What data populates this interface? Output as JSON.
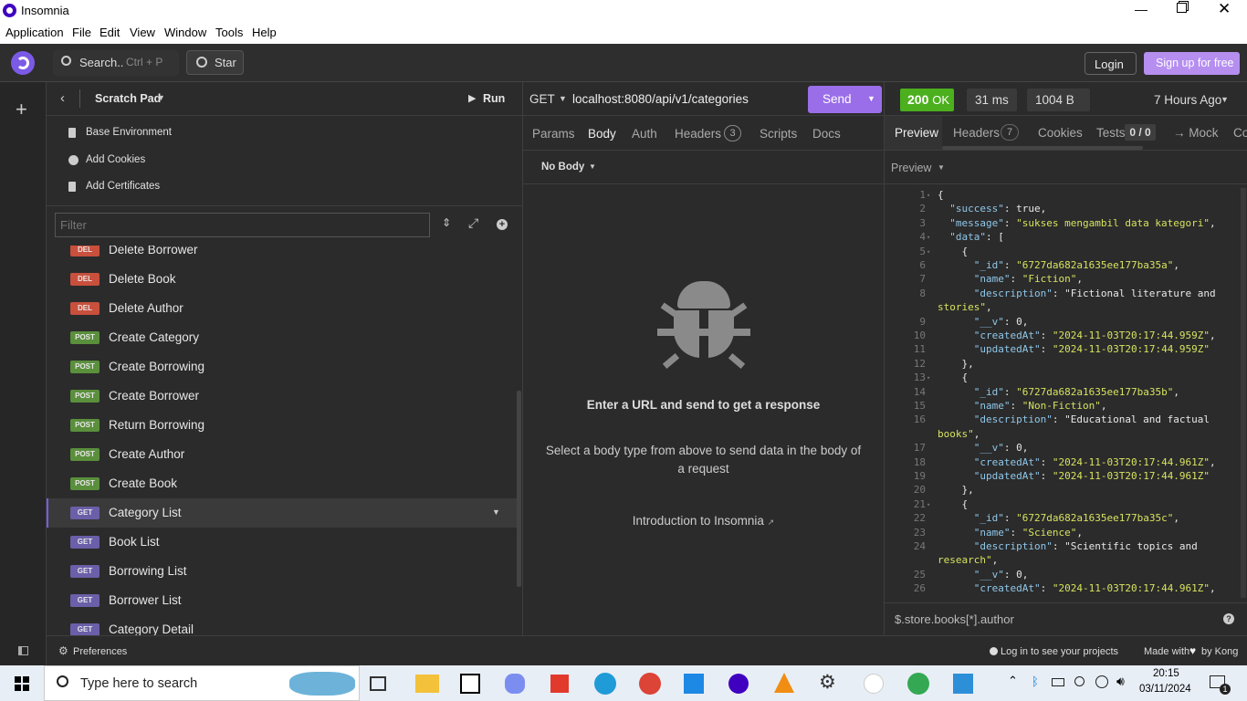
{
  "window": {
    "title": "Insomnia",
    "menu": [
      "Application",
      "File",
      "Edit",
      "View",
      "Window",
      "Tools",
      "Help"
    ]
  },
  "topbar": {
    "search_label": "Search..",
    "search_shortcut": "Ctrl + P",
    "star_label": "Star",
    "login_label": "Login",
    "signup_label": "Sign up for free"
  },
  "sidebar": {
    "title": "Scratch Pad",
    "run_label": "Run",
    "links": [
      "Base Environment",
      "Add Cookies",
      "Add Certificates"
    ],
    "filter_placeholder": "Filter",
    "requests": [
      {
        "method": "DEL",
        "name": "Delete Borrower"
      },
      {
        "method": "DEL",
        "name": "Delete Book"
      },
      {
        "method": "DEL",
        "name": "Delete Author"
      },
      {
        "method": "POST",
        "name": "Create Category"
      },
      {
        "method": "POST",
        "name": "Create Borrowing"
      },
      {
        "method": "POST",
        "name": "Create Borrower"
      },
      {
        "method": "POST",
        "name": "Return Borrowing"
      },
      {
        "method": "POST",
        "name": "Create Author"
      },
      {
        "method": "POST",
        "name": "Create Book"
      },
      {
        "method": "GET",
        "name": "Category List"
      },
      {
        "method": "GET",
        "name": "Book List"
      },
      {
        "method": "GET",
        "name": "Borrowing List"
      },
      {
        "method": "GET",
        "name": "Borrower List"
      },
      {
        "method": "GET",
        "name": "Category Detail"
      }
    ],
    "active_request": "Category List"
  },
  "request": {
    "method": "GET",
    "url": "localhost:8080/api/v1/categories",
    "send_label": "Send",
    "tabs": [
      "Params",
      "Body",
      "Auth",
      "Headers",
      "Scripts",
      "Docs"
    ],
    "headers_count": "3",
    "active_tab": "Body",
    "body_type": "No Body",
    "empty_title": "Enter a URL and send to get a response",
    "empty_desc": "Select a body type from above to send data in the body of a request",
    "intro_link": "Introduction to Insomnia"
  },
  "response": {
    "status": "200",
    "status_text": "OK",
    "time": "31 ms",
    "size": "1004 B",
    "age": "7 Hours Ago",
    "tabs": [
      "Preview",
      "Headers",
      "Cookies",
      "Tests",
      "→ Mock",
      "Co"
    ],
    "headers_count": "7",
    "tests_count": "0 / 0",
    "preview_label": "Preview",
    "filter_text": "$.store.books[*].author",
    "lines": [
      {
        "n": "1",
        "fold": true,
        "t": "{"
      },
      {
        "n": "2",
        "t": "  \"success\": true,"
      },
      {
        "n": "3",
        "t": "  \"message\": \"sukses mengambil data kategori\","
      },
      {
        "n": "4",
        "fold": true,
        "t": "  \"data\": ["
      },
      {
        "n": "5",
        "fold": true,
        "t": "    {"
      },
      {
        "n": "6",
        "t": "      \"_id\": \"6727da682a1635ee177ba35a\","
      },
      {
        "n": "7",
        "t": "      \"name\": \"Fiction\","
      },
      {
        "n": "8",
        "t": "      \"description\": \"Fictional literature and"
      },
      {
        "n": "",
        "t": "stories\","
      },
      {
        "n": "9",
        "t": "      \"__v\": 0,"
      },
      {
        "n": "10",
        "t": "      \"createdAt\": \"2024-11-03T20:17:44.959Z\","
      },
      {
        "n": "11",
        "t": "      \"updatedAt\": \"2024-11-03T20:17:44.959Z\""
      },
      {
        "n": "12",
        "t": "    },"
      },
      {
        "n": "13",
        "fold": true,
        "t": "    {"
      },
      {
        "n": "14",
        "t": "      \"_id\": \"6727da682a1635ee177ba35b\","
      },
      {
        "n": "15",
        "t": "      \"name\": \"Non-Fiction\","
      },
      {
        "n": "16",
        "t": "      \"description\": \"Educational and factual"
      },
      {
        "n": "",
        "t": "books\","
      },
      {
        "n": "17",
        "t": "      \"__v\": 0,"
      },
      {
        "n": "18",
        "t": "      \"createdAt\": \"2024-11-03T20:17:44.961Z\","
      },
      {
        "n": "19",
        "t": "      \"updatedAt\": \"2024-11-03T20:17:44.961Z\""
      },
      {
        "n": "20",
        "t": "    },"
      },
      {
        "n": "21",
        "fold": true,
        "t": "    {"
      },
      {
        "n": "22",
        "t": "      \"_id\": \"6727da682a1635ee177ba35c\","
      },
      {
        "n": "23",
        "t": "      \"name\": \"Science\","
      },
      {
        "n": "24",
        "t": "      \"description\": \"Scientific topics and"
      },
      {
        "n": "",
        "t": "research\","
      },
      {
        "n": "25",
        "t": "      \"__v\": 0,"
      },
      {
        "n": "26",
        "t": "      \"createdAt\": \"2024-11-03T20:17:44.961Z\","
      }
    ]
  },
  "statusbar": {
    "preferences": "Preferences",
    "login_hint": "Log in to see your projects",
    "made_with": "Made with",
    "by": "by Kong"
  },
  "taskbar": {
    "search_placeholder": "Type here to search",
    "time": "20:15",
    "date": "03/11/2024",
    "notif_count": "1"
  },
  "colors": {
    "accent": "#7b5ae6",
    "ok": "#4caf1e"
  }
}
